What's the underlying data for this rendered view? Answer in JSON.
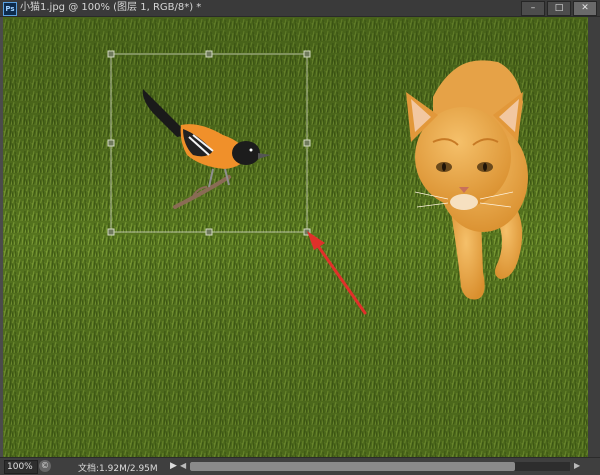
{
  "window": {
    "app_icon": "Ps",
    "title": "小猫1.jpg @ 100% (图层 1, RGB/8*) *",
    "buttons": {
      "minimize": "–",
      "restore": "□",
      "close": "✕"
    }
  },
  "status": {
    "zoom": "100%",
    "doc_size": "文档:1.92M/2.95M",
    "menu_arrow": "▶"
  },
  "colors": {
    "grass": "#56751f",
    "cat": "#e8a94a",
    "bird_orange": "#f0902a",
    "arrow": "#e0302a"
  },
  "icons": {
    "app": "photoshop-icon",
    "transform": "transform-handle-icon",
    "annotation": "red-arrow-icon"
  }
}
